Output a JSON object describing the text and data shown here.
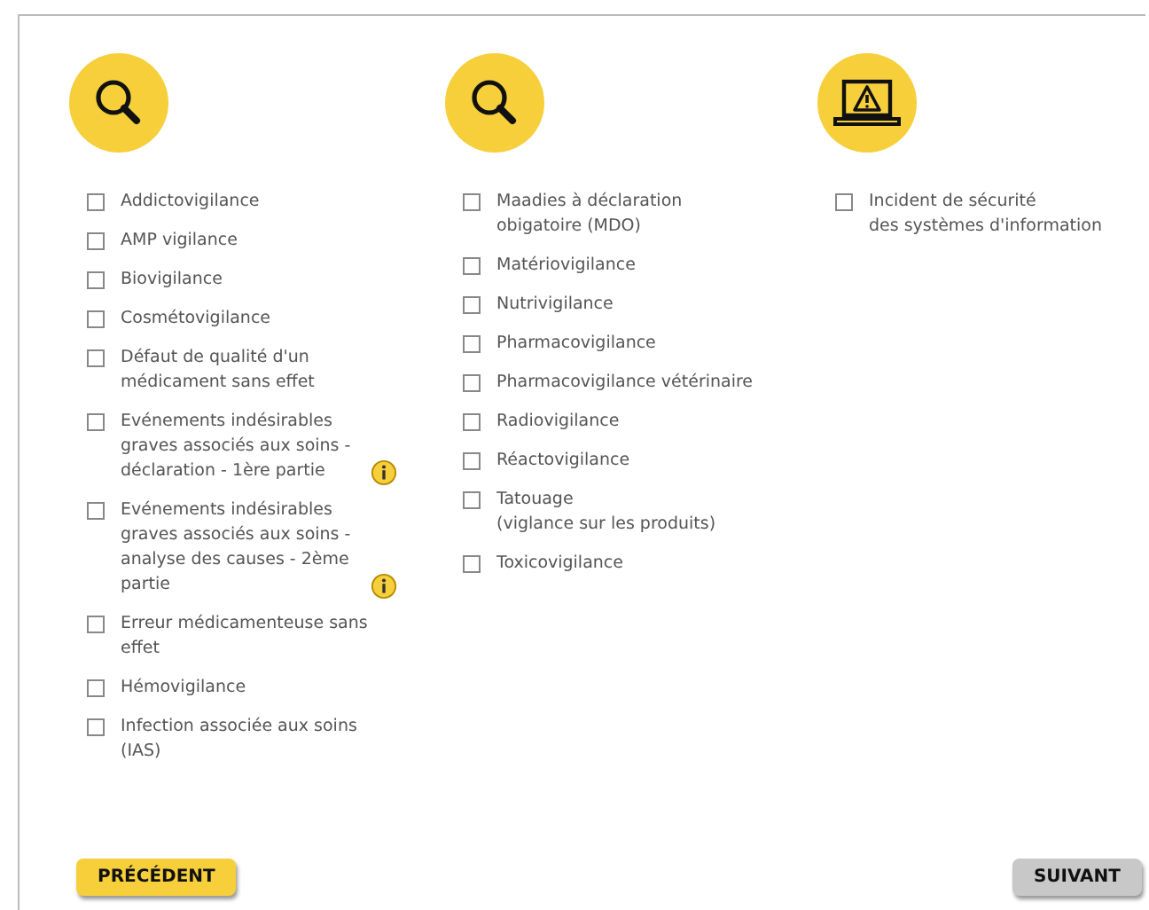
{
  "columns": [
    {
      "kind": "search",
      "items": [
        {
          "label": "Addictovigilance",
          "checked": false,
          "info": false
        },
        {
          "label": "AMP vigilance",
          "checked": false,
          "info": false
        },
        {
          "label": "Biovigilance",
          "checked": false,
          "info": false
        },
        {
          "label": "Cosmétovigilance",
          "checked": false,
          "info": false
        },
        {
          "label": "Défaut de qualité d'un médicament sans effet",
          "checked": false,
          "info": false
        },
        {
          "label": "Evénements indésirables graves associés aux soins - déclaration - 1ère partie",
          "checked": false,
          "info": true
        },
        {
          "label": "Evénements indésirables graves associés aux soins - analyse des causes - 2ème partie",
          "checked": false,
          "info": true
        },
        {
          "label": "Erreur médicamenteuse sans effet",
          "checked": false,
          "info": false
        },
        {
          "label": "Hémovigilance",
          "checked": false,
          "info": false
        },
        {
          "label": "Infection associée aux soins (IAS)",
          "checked": false,
          "info": false
        }
      ]
    },
    {
      "kind": "search",
      "items": [
        {
          "label": "Maadies à déclaration\nobigatoire (MDO)",
          "checked": false,
          "info": false
        },
        {
          "label": "Matériovigilance",
          "checked": false,
          "info": false
        },
        {
          "label": "Nutrivigilance",
          "checked": false,
          "info": false
        },
        {
          "label": "Pharmacovigilance",
          "checked": false,
          "info": false
        },
        {
          "label": "Pharmacovigilance vétérinaire",
          "checked": false,
          "info": false
        },
        {
          "label": "Radiovigilance",
          "checked": false,
          "info": false
        },
        {
          "label": "Réactovigilance",
          "checked": false,
          "info": false
        },
        {
          "label": "Tatouage\n(viglance sur les produits)",
          "checked": false,
          "info": false
        },
        {
          "label": "Toxicovigilance",
          "checked": false,
          "info": false
        }
      ]
    },
    {
      "kind": "alert",
      "items": [
        {
          "label": "Incident de sécurité\ndes systèmes d'information",
          "checked": false,
          "info": false
        }
      ]
    }
  ],
  "buttons": [
    {
      "label": "PRÉCÉDENT",
      "kind": "primary"
    },
    {
      "label": "SUIVANT",
      "kind": "secondary"
    }
  ]
}
